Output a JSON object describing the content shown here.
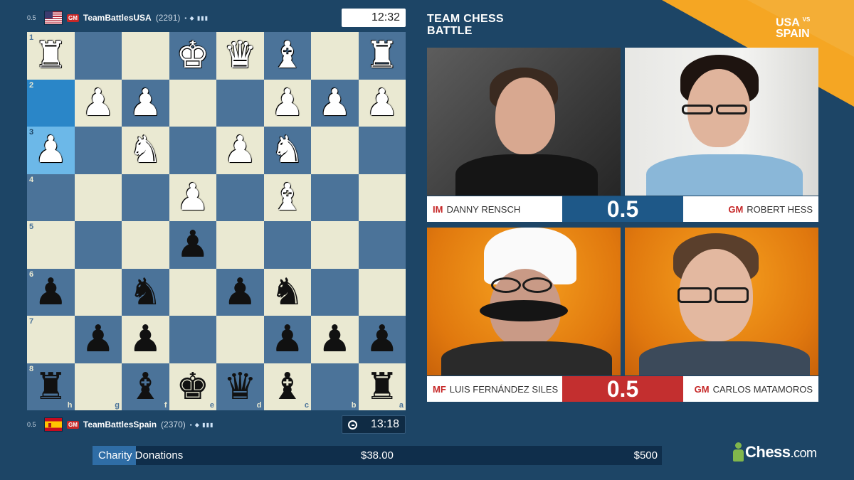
{
  "top_player": {
    "score": "0.5",
    "title": "GM",
    "name": "TeamBattlesUSA",
    "rating": "(2291)",
    "flag": "usa-flag",
    "clock": "12:32"
  },
  "bottom_player": {
    "score": "0.5",
    "title": "GM",
    "name": "TeamBattlesSpain",
    "rating": "(2370)",
    "flag": "spain-flag",
    "clock": "13:18"
  },
  "board": {
    "orientation": "black-bottom",
    "rank_labels": [
      "1",
      "2",
      "3",
      "4",
      "5",
      "6",
      "7",
      "8"
    ],
    "file_labels": [
      "h",
      "g",
      "f",
      "e",
      "d",
      "c",
      "b",
      "a"
    ],
    "rows": [
      [
        "R",
        "",
        "",
        "K",
        "Q",
        "B",
        "",
        "R"
      ],
      [
        "",
        "P",
        "P",
        "",
        "",
        "P",
        "P",
        "P"
      ],
      [
        "P",
        "",
        "N",
        "",
        "P",
        "N",
        "",
        ""
      ],
      [
        "",
        "",
        "",
        "P",
        "",
        "B",
        "",
        ""
      ],
      [
        "",
        "",
        "",
        "p",
        "",
        "",
        "",
        ""
      ],
      [
        "p",
        "",
        "n",
        "",
        "p",
        "n",
        "",
        ""
      ],
      [
        "",
        "p",
        "p",
        "",
        "",
        "p",
        "p",
        "p"
      ],
      [
        "r",
        "",
        "b",
        "k",
        "q",
        "b",
        "",
        "r"
      ]
    ],
    "highlighted": [
      "a2",
      "a3"
    ],
    "highlight_colors": {
      "dark": "#2a86c8",
      "light": "#6cb8e8"
    }
  },
  "event": {
    "title_line1": "TEAM CHESS",
    "title_line2": "BATTLE",
    "matchup_line1": "USA",
    "matchup_vs": "VS",
    "matchup_line2": "SPAIN"
  },
  "matches": [
    {
      "left": {
        "title": "IM",
        "name": "DANNY RENSCH"
      },
      "score": "0.5",
      "score_color": "#1e5888",
      "right": {
        "title": "GM",
        "name": "ROBERT HESS"
      }
    },
    {
      "left": {
        "title": "MF",
        "name": "LUIS FERNÁNDEZ SILES"
      },
      "score": "0.5",
      "score_color": "#c32f2f",
      "right": {
        "title": "GM",
        "name": "CARLOS MATAMOROS"
      }
    }
  ],
  "charity": {
    "label": "Charity Donations",
    "raised": "$38.00",
    "goal": "$500",
    "progress_fraction": 0.076
  },
  "brand": {
    "name": "Chess",
    "suffix": ".com",
    "accent": "#f5a623",
    "logo_green": "#81b64c"
  }
}
